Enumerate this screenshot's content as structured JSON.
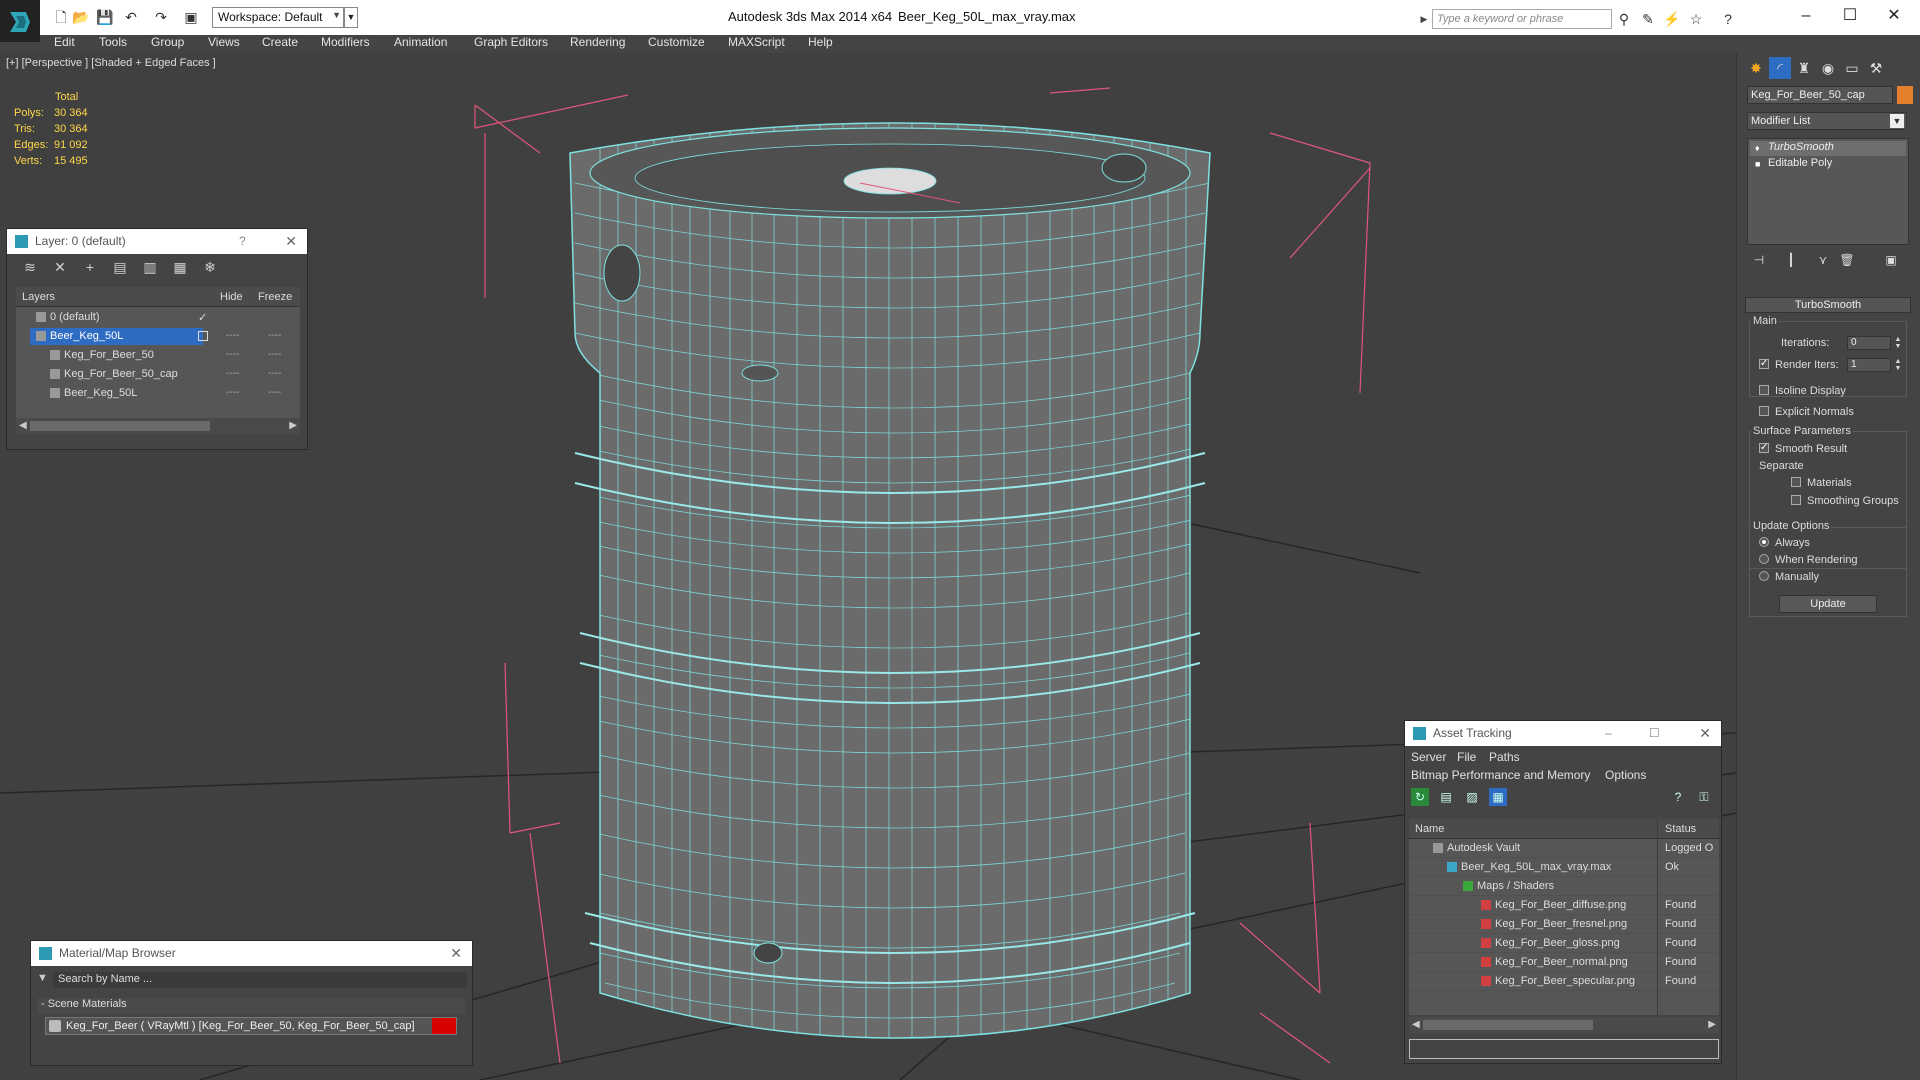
{
  "titlebar": {
    "workspace": "Workspace: Default",
    "app_title": "Autodesk 3ds Max  2014 x64",
    "file_title": "Beer_Keg_50L_max_vray.max",
    "search_placeholder": "Type a keyword or phrase"
  },
  "menu": [
    "Edit",
    "Tools",
    "Group",
    "Views",
    "Create",
    "Modifiers",
    "Animation",
    "Graph Editors",
    "Rendering",
    "Customize",
    "MAXScript",
    "Help"
  ],
  "viewport": {
    "label": "[+] [Perspective ] [Shaded + Edged Faces ]",
    "stats_total": "Total",
    "stats": [
      {
        "key": "Polys:",
        "value": "30 364"
      },
      {
        "key": "Tris:",
        "value": "30 364"
      },
      {
        "key": "Edges:",
        "value": "91 092"
      },
      {
        "key": "Verts:",
        "value": "15 495"
      }
    ],
    "wire_color": "#7fe0e0",
    "bbox_color": "#e0567a"
  },
  "layers_panel": {
    "title": "Layer: 0 (default)",
    "help": "?",
    "col_layers": "Layers",
    "col_hide": "Hide",
    "col_freeze": "Freeze",
    "rows": [
      {
        "name": "0 (default)",
        "checked": "✓"
      },
      {
        "name": "Beer_Keg_50L"
      },
      {
        "name": "Keg_For_Beer_50"
      },
      {
        "name": "Keg_For_Beer_50_cap"
      },
      {
        "name": "Beer_Keg_50L"
      }
    ],
    "dash": "----"
  },
  "material_browser": {
    "title": "Material/Map Browser",
    "search_placeholder": "Search by Name ...",
    "group": "- Scene Materials",
    "item": "Keg_For_Beer  ( VRayMtl )  [Keg_For_Beer_50, Keg_For_Beer_50_cap]",
    "swatch_color": "#d80000"
  },
  "asset_tracking": {
    "title": "Asset Tracking",
    "menu1": [
      "Server",
      "File",
      "Paths"
    ],
    "menu2": [
      "Bitmap Performance and Memory",
      "Options"
    ],
    "col_name": "Name",
    "col_status": "Status",
    "rows": [
      {
        "name": "Autodesk Vault",
        "status": "Logged O"
      },
      {
        "name": "Beer_Keg_50L_max_vray.max",
        "status": "Ok"
      },
      {
        "name": "Maps / Shaders",
        "status": ""
      },
      {
        "name": "Keg_For_Beer_diffuse.png",
        "status": "Found"
      },
      {
        "name": "Keg_For_Beer_fresnel.png",
        "status": "Found"
      },
      {
        "name": "Keg_For_Beer_gloss.png",
        "status": "Found"
      },
      {
        "name": "Keg_For_Beer_normal.png",
        "status": "Found"
      },
      {
        "name": "Keg_For_Beer_specular.png",
        "status": "Found"
      }
    ]
  },
  "command_panel": {
    "object_name": "Keg_For_Beer_50_cap",
    "object_color": "#e67f2c",
    "modifier_list": "Modifier List",
    "stack": [
      "TurboSmooth",
      "Editable Poly"
    ],
    "rollout_title": "TurboSmooth",
    "main_label": "Main",
    "iterations_label": "Iterations:",
    "iterations_value": "0",
    "render_iters_label": "Render Iters:",
    "render_iters_value": "1",
    "isoline": "Isoline Display",
    "explicit_normals": "Explicit Normals",
    "surface_params": "Surface Parameters",
    "smooth_result": "Smooth Result",
    "separate": "Separate",
    "materials": "Materials",
    "smoothing_groups": "Smoothing Groups",
    "update_options": "Update Options",
    "always": "Always",
    "when_rendering": "When Rendering",
    "manually": "Manually",
    "update_button": "Update"
  }
}
